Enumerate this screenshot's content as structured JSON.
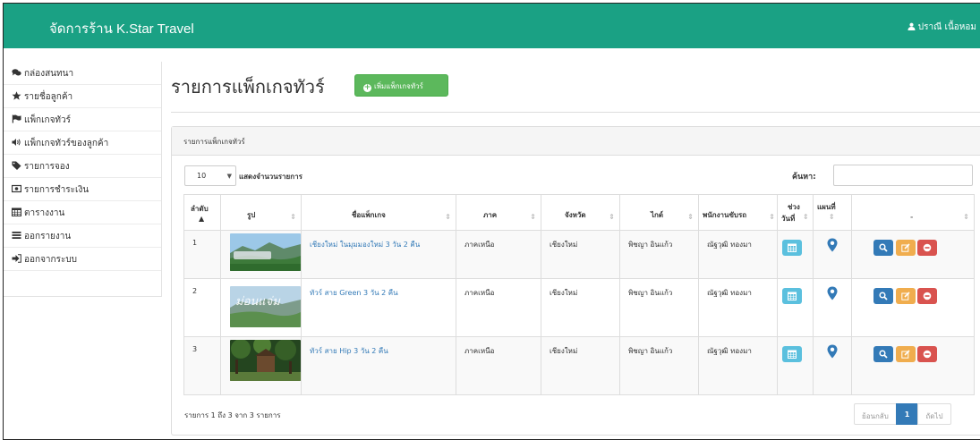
{
  "navbar": {
    "brand": "จัดการร้าน K.Star Travel",
    "user_name": "ปราณี เนื้อหอม"
  },
  "sidebar": {
    "items": [
      {
        "label": "กล่องสนทนา",
        "icon": "comments-icon"
      },
      {
        "label": "รายชื่อลูกค้า",
        "icon": "star-icon"
      },
      {
        "label": "แพ็กเกจทัวร์",
        "icon": "flag-icon"
      },
      {
        "label": "แพ็กเกจทัวร์ของลูกค้า",
        "icon": "volume-icon"
      },
      {
        "label": "รายการจอง",
        "icon": "tag-icon"
      },
      {
        "label": "รายการชำระเงิน",
        "icon": "money-icon"
      },
      {
        "label": "ตารางงาน",
        "icon": "calendar-icon"
      },
      {
        "label": "ออกรายงาน",
        "icon": "list-icon"
      },
      {
        "label": "ออกจากระบบ",
        "icon": "sign-out-icon"
      }
    ]
  },
  "page": {
    "title": "รายการแพ็กเกจทัวร์",
    "add_button": "เพิ่มแพ็กเกจทัวร์"
  },
  "panel": {
    "heading": "รายการแพ็กเกจทัวร์"
  },
  "controls": {
    "page_length": "10",
    "page_length_label": "แสดงจำนวนรายการ",
    "search_label": "ค้นหา:",
    "search_value": ""
  },
  "table": {
    "headers": {
      "no": "ลำดับ",
      "picture": "รูป",
      "name": "ชื่อแพ็กเกจ",
      "region": "ภาค",
      "province": "จังหวัด",
      "guide": "ไกด์",
      "driver": "พนักงานขับรถ",
      "period_1": "ช่วง",
      "period_2": "วันที่",
      "map": "แผนที่",
      "actions": "-"
    },
    "rows": [
      {
        "no": "1",
        "name": "เชียงใหม่ ในมุมมองใหม่ 3 วัน 2 คืน",
        "region": "ภาคเหนือ",
        "province": "เชียงใหม่",
        "guide": "พิชญา อินแก้ว",
        "driver": "ณัฐวุฒิ ทองมา"
      },
      {
        "no": "2",
        "name": "ทัวร์ สาย Green 3 วัน 2 คืน",
        "region": "ภาคเหนือ",
        "province": "เชียงใหม่",
        "guide": "พิชญา อินแก้ว",
        "driver": "ณัฐวุฒิ ทองมา"
      },
      {
        "no": "3",
        "name": "ทัวร์ สาย Hip 3 วัน 2 คืน",
        "region": "ภาคเหนือ",
        "province": "เชียงใหม่",
        "guide": "พิชญา อินแก้ว",
        "driver": "ณัฐวุฒิ ทองมา"
      }
    ]
  },
  "footer": {
    "info": "รายการ 1 ถึง 3 จาก 3 รายการ",
    "prev": "ย้อนกลับ",
    "current_page": "1",
    "next": "ถัดไป"
  },
  "colors": {
    "navbar": "#1aa184",
    "add_button": "#5cb85c",
    "link": "#337ab7",
    "btn_info": "#5bc0de",
    "btn_primary": "#337ab7",
    "btn_warning": "#f0ad4e",
    "btn_danger": "#d9534f"
  }
}
